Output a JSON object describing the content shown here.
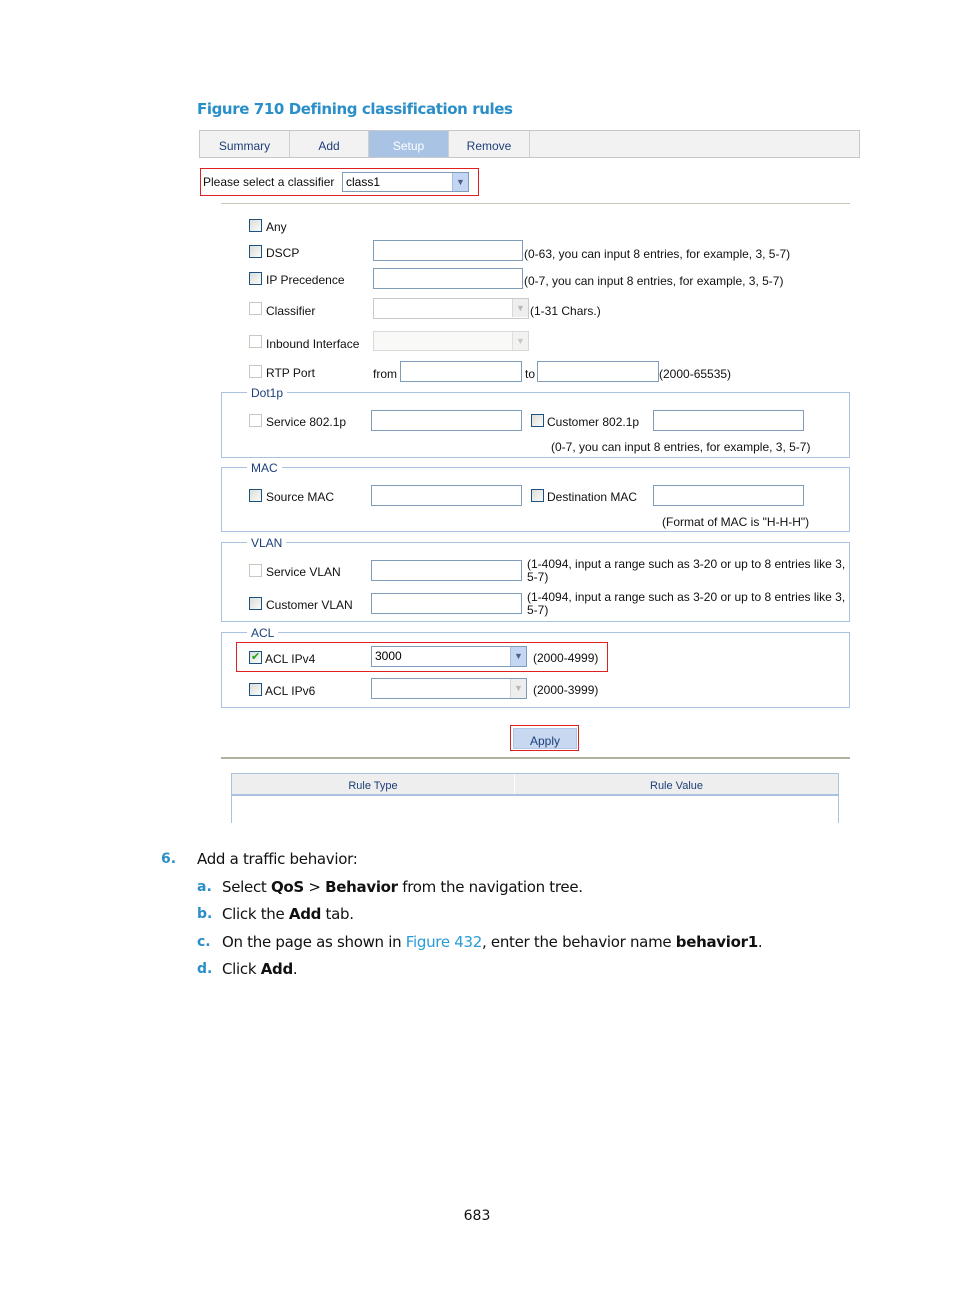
{
  "figure_title": "Figure 710 Defining classification rules",
  "tabs": [
    {
      "label": "Summary",
      "active": false
    },
    {
      "label": "Add",
      "active": false
    },
    {
      "label": "Setup",
      "active": true
    },
    {
      "label": "Remove",
      "active": false
    }
  ],
  "classifier_select": {
    "label": "Please select a classifier",
    "value": "class1"
  },
  "rules": {
    "any": {
      "label": "Any",
      "checked": false
    },
    "dscp": {
      "label": "DSCP",
      "value": "",
      "hint": "(0-63, you can input 8 entries, for example, 3, 5-7)"
    },
    "ip_precedence": {
      "label": "IP Precedence",
      "value": "",
      "hint": "(0-7, you can input 8 entries, for example, 3, 5-7)"
    },
    "classifier": {
      "label": "Classifier",
      "value": "",
      "hint": "(1-31 Chars.)"
    },
    "inbound_interface": {
      "label": "Inbound Interface",
      "value": ""
    },
    "rtp_port": {
      "label": "RTP Port",
      "from_label": "from",
      "to_label": "to",
      "from_value": "",
      "to_value": "",
      "hint": "(2000-65535)"
    }
  },
  "dot1p": {
    "legend": "Dot1p",
    "service_label": "Service 802.1p",
    "service_value": "",
    "customer_label": "Customer 802.1p",
    "customer_value": "",
    "hint": "(0-7, you can input 8 entries, for example, 3, 5-7)"
  },
  "mac": {
    "legend": "MAC",
    "source_label": "Source MAC",
    "source_value": "",
    "dest_label": "Destination MAC",
    "dest_value": "",
    "hint": "(Format of MAC is \"H-H-H\")"
  },
  "vlan": {
    "legend": "VLAN",
    "service_label": "Service VLAN",
    "service_value": "",
    "service_hint": "(1-4094, input a range such as 3-20 or up to 8 entries like 3, 5-7)",
    "customer_label": "Customer VLAN",
    "customer_value": "",
    "customer_hint": "(1-4094, input a range such as 3-20 or up to 8 entries like 3, 5-7)"
  },
  "acl": {
    "legend": "ACL",
    "ipv4_label": "ACL IPv4",
    "ipv4_checked": true,
    "ipv4_value": "3000",
    "ipv4_hint": "(2000-4999)",
    "ipv6_label": "ACL IPv6",
    "ipv6_checked": false,
    "ipv6_value": "",
    "ipv6_hint": "(2000-3999)"
  },
  "apply_label": "Apply",
  "rule_table": {
    "columns": [
      "Rule Type",
      "Rule Value"
    ],
    "rows": []
  },
  "steps": {
    "main_num": "6.",
    "main_text": "Add a traffic behavior:",
    "a": {
      "num": "a.",
      "pre": "Select ",
      "b1": "QoS",
      "mid": " > ",
      "b2": "Behavior",
      "post": " from the navigation tree."
    },
    "b": {
      "num": "b.",
      "pre": "Click the ",
      "b1": "Add",
      "post": " tab."
    },
    "c": {
      "num": "c.",
      "pre": "On the page as shown in ",
      "link": "Figure 432",
      "mid": ", enter the behavior name ",
      "b1": "behavior1",
      "post": "."
    },
    "d": {
      "num": "d.",
      "pre": "Click ",
      "b1": "Add",
      "post": "."
    }
  },
  "page_number": "683"
}
